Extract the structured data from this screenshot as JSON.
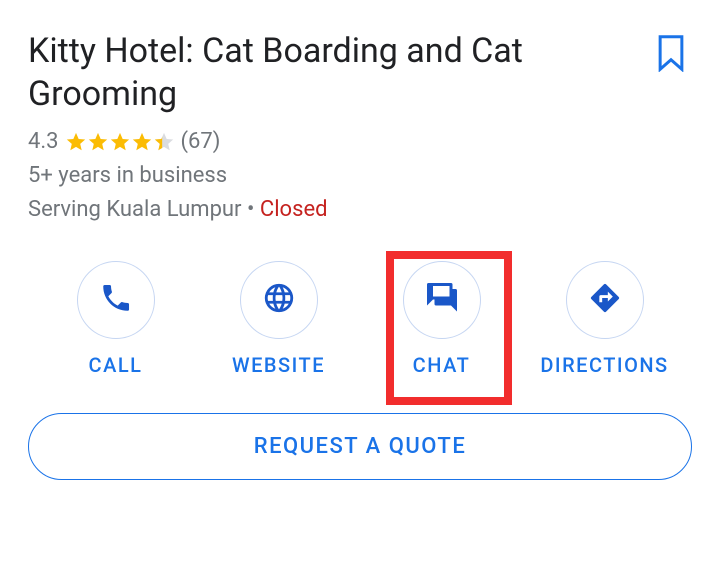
{
  "business": {
    "name": "Kitty Hotel: Cat Boarding and Cat Grooming",
    "rating": "4.3",
    "review_count": "(67)",
    "tenure": "5+ years in business",
    "serving": "Serving Kuala Lumpur",
    "status": "Closed",
    "separator": "•"
  },
  "actions": {
    "call": "CALL",
    "website": "WEBSITE",
    "chat": "CHAT",
    "directions": "DIRECTIONS"
  },
  "cta": {
    "request_quote": "REQUEST A QUOTE"
  },
  "stars_value": 4.3
}
